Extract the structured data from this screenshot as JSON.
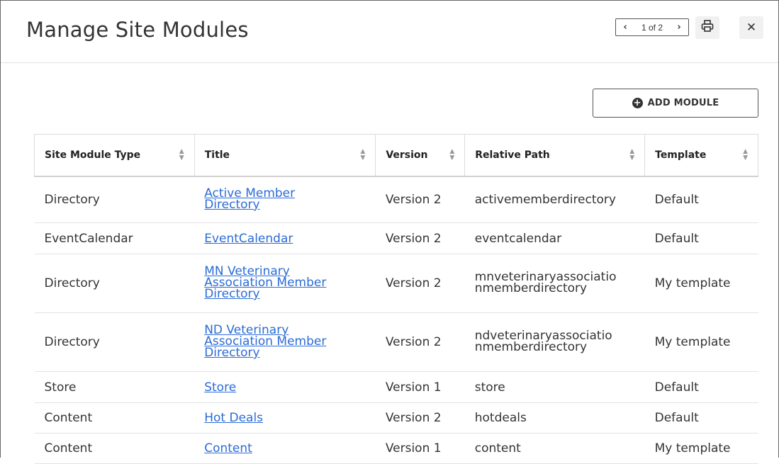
{
  "dialog": {
    "title": "Manage Site Modules",
    "pager": {
      "label": "1 of 2",
      "prev": "‹",
      "next": "›"
    },
    "close_glyph": "✕"
  },
  "toolbar": {
    "add_label": "ADD MODULE"
  },
  "table": {
    "headers": [
      "Site Module Type",
      "Title",
      "Version",
      "Relative Path",
      "Template"
    ],
    "rows": [
      {
        "type": "Directory",
        "title_line1": "Active Member",
        "title_line2": "Directory",
        "title_line3": "",
        "version": "Version 2",
        "path_line1": "activememberdirectory",
        "path_line2": "",
        "template": "Default"
      },
      {
        "type": "EventCalendar",
        "title_line1": "EventCalendar",
        "title_line2": "",
        "title_line3": "",
        "version": "Version 2",
        "path_line1": "eventcalendar",
        "path_line2": "",
        "template": "Default"
      },
      {
        "type": "Directory",
        "title_line1": "MN Veterinary",
        "title_line2": "Association Member",
        "title_line3": "Directory",
        "version": "Version 2",
        "path_line1": "mnveterinaryassociatio",
        "path_line2": "nmemberdirectory",
        "template": "My template"
      },
      {
        "type": "Directory",
        "title_line1": "ND Veterinary",
        "title_line2": "Association Member",
        "title_line3": "Directory",
        "version": "Version 2",
        "path_line1": "ndveterinaryassociatio",
        "path_line2": "nmemberdirectory",
        "template": "My template"
      },
      {
        "type": "Store",
        "title_line1": "Store",
        "title_line2": "",
        "title_line3": "",
        "version": "Version 1",
        "path_line1": "store",
        "path_line2": "",
        "template": "Default"
      },
      {
        "type": "Content",
        "title_line1": "Hot Deals",
        "title_line2": "",
        "title_line3": "",
        "version": "Version 2",
        "path_line1": "hotdeals",
        "path_line2": "",
        "template": "Default"
      },
      {
        "type": "Content",
        "title_line1": "Content",
        "title_line2": "",
        "title_line3": "",
        "version": "Version 1",
        "path_line1": "content",
        "path_line2": "",
        "template": "My template"
      }
    ]
  },
  "icons": {
    "print": "printer-icon",
    "close": "close-icon",
    "add": "plus-circle-icon",
    "sort": "sort-icon"
  },
  "colors": {
    "link": "#2b6cd6",
    "border": "#dcdcdc"
  }
}
